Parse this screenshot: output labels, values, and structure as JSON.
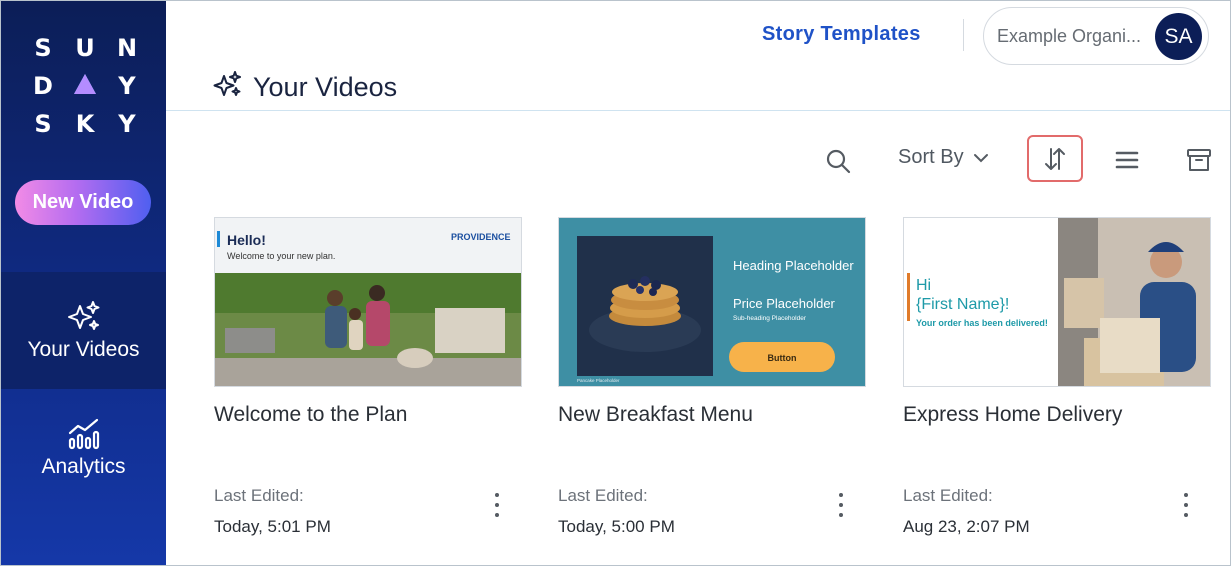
{
  "sidebar": {
    "logo_rows": [
      [
        "S",
        "U",
        "N"
      ],
      [
        "D",
        "",
        "Y"
      ],
      [
        "S",
        "K",
        "Y"
      ]
    ],
    "new_video_label": "New Video",
    "nav": [
      {
        "label": "Your Videos",
        "icon": "sparkle-icon",
        "active": true
      },
      {
        "label": "Analytics",
        "icon": "analytics-icon",
        "active": false
      }
    ]
  },
  "header": {
    "story_templates_label": "Story Templates",
    "org_name": "Example Organi...",
    "avatar_initials": "SA",
    "page_title": "Your Videos"
  },
  "toolbar": {
    "sort_by_label": "Sort By",
    "icons": [
      "search-icon",
      "chevron-down-icon",
      "sort-direction-icon",
      "list-view-icon",
      "archive-icon"
    ]
  },
  "videos": [
    {
      "title": "Welcome to the Plan",
      "edited_label": "Last Edited:",
      "edited_value": "Today, 5:01 PM",
      "thumb": {
        "greeting": "Hello!",
        "sub": "Welcome to your new plan.",
        "brand": "PROVIDENCE"
      }
    },
    {
      "title": "New Breakfast Menu",
      "edited_label": "Last Edited:",
      "edited_value": "Today, 5:00 PM",
      "thumb": {
        "heading": "Heading Placeholder",
        "price": "Price Placeholder",
        "sub": "Sub-heading Placeholder",
        "button": "Button",
        "footer": "Pancake Placeholder"
      }
    },
    {
      "title": "Express Home Delivery",
      "edited_label": "Last Edited:",
      "edited_value": "Aug 23, 2:07 PM",
      "thumb": {
        "hi": "Hi",
        "name": "{First Name}!",
        "msg": "Your order has been delivered!"
      }
    }
  ],
  "colors": {
    "sidebar_top": "#0c1e57",
    "link_blue": "#1f52c7",
    "sort_highlight": "#e26b6b",
    "breakfast_teal": "#3e8fa4",
    "button_orange": "#f7b24a",
    "delivery_orange": "#e07b2a",
    "delivery_teal": "#1e9aa8"
  }
}
